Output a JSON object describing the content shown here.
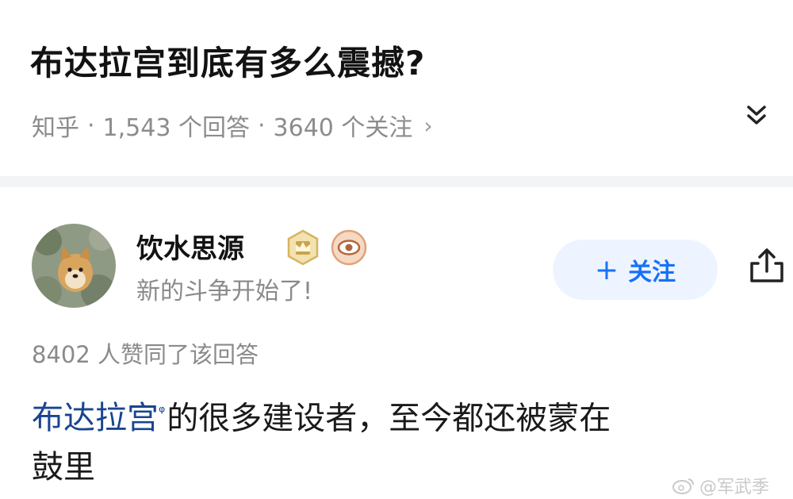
{
  "question": {
    "title": "布达拉宫到底有多么震撼?",
    "source": "知乎",
    "answers_count": "1,543 个回答",
    "followers_count": "3640 个关注",
    "separator": "·",
    "chevron": "›"
  },
  "answer": {
    "author_name": "饮水思源",
    "author_bio": "新的斗争开始了!",
    "follow_button": "关注",
    "follow_plus": "+",
    "votes": "8402 人赞同了该回答",
    "link_text": "布达拉宫",
    "body_line1_rest": "的很多建设者，至今都还被蒙在",
    "body_line2": "鼓里"
  },
  "watermark": "@军武季",
  "colors": {
    "accent": "#1772f6",
    "link": "#19458f",
    "muted": "#8a8a8a"
  },
  "icons": {
    "expand": "double-chevron-down-icon",
    "share": "share-icon",
    "badge1": "crown-badge-icon",
    "badge2": "eye-badge-icon"
  }
}
